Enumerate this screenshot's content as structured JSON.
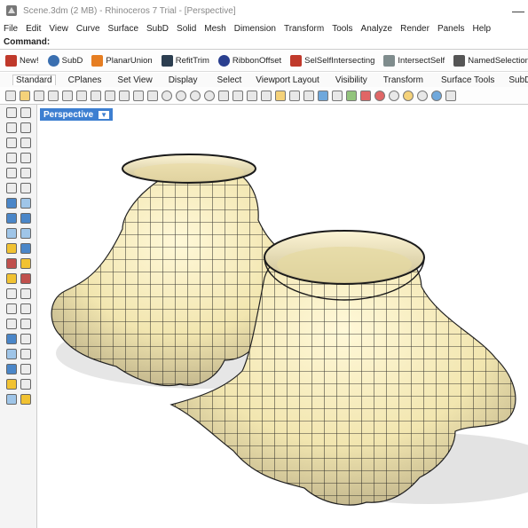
{
  "window": {
    "title": "Scene.3dm (2 MB) - Rhinoceros 7 Trial - [Perspective]"
  },
  "menu": [
    "File",
    "Edit",
    "View",
    "Curve",
    "Surface",
    "SubD",
    "Solid",
    "Mesh",
    "Dimension",
    "Transform",
    "Tools",
    "Analyze",
    "Render",
    "Panels",
    "Help"
  ],
  "command": {
    "label": "Command:"
  },
  "quick": [
    {
      "label": "New!",
      "color": "#c0392b",
      "icon": "new-icon"
    },
    {
      "label": "SubD",
      "color": "#3a6fb0",
      "icon": "subd-icon"
    },
    {
      "label": "PlanarUnion",
      "color": "#e67e22",
      "icon": "planar-union-icon"
    },
    {
      "label": "RefitTrim",
      "color": "#2c3e50",
      "icon": "refit-trim-icon"
    },
    {
      "label": "RibbonOffset",
      "color": "#2a3f8f",
      "icon": "ribbon-offset-icon"
    },
    {
      "label": "SelSelfIntersecting",
      "color": "#c0392b",
      "icon": "sel-self-intersecting-icon"
    },
    {
      "label": "IntersectSelf",
      "color": "#7f8c8d",
      "icon": "intersect-self-icon"
    },
    {
      "label": "NamedSelection",
      "color": "#555555",
      "icon": "named-selection-icon"
    }
  ],
  "tabs": [
    "Standard",
    "CPlanes",
    "Set View",
    "Display",
    "Select",
    "Viewport Layout",
    "Visibility",
    "Transform",
    "Surface Tools",
    "SubD Tools"
  ],
  "active_tab": "Standard",
  "viewport": {
    "name": "Perspective",
    "arrow": "▼"
  }
}
